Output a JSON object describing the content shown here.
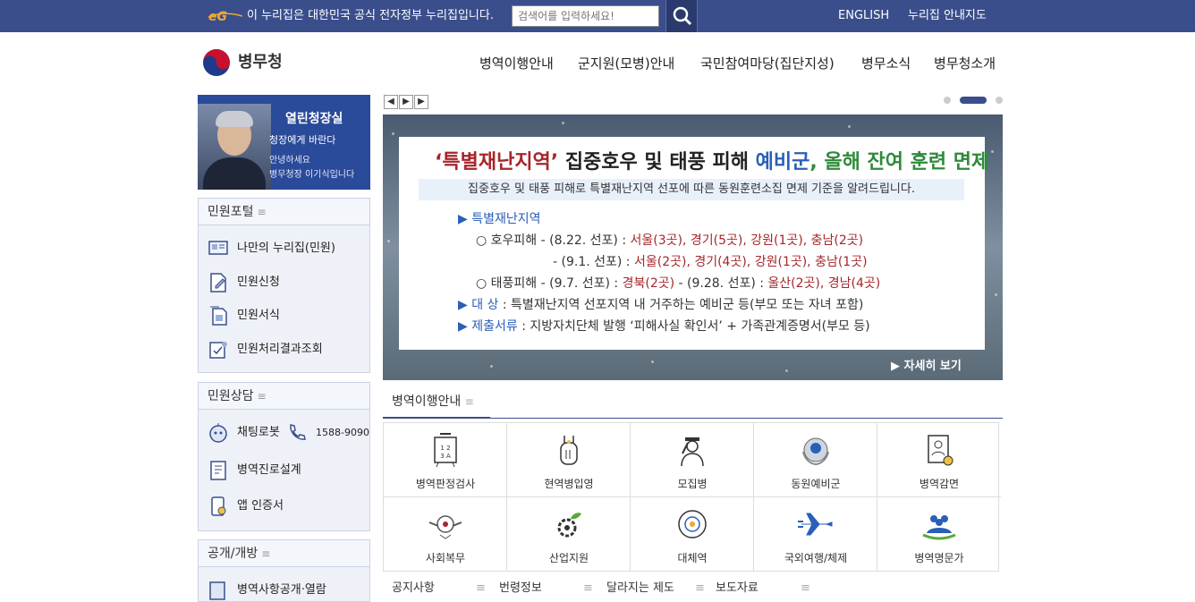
{
  "topbar": {
    "notice": "이 누리집은 대한민국 공식 전자정부 누리집입니다.",
    "search_placeholder": "검색어를 입력하세요!",
    "english": "ENGLISH",
    "sitemap": "누리집 안내지도"
  },
  "logo": {
    "name": "병무청"
  },
  "gnb": [
    "병역이행안내",
    "군지원(모병)안내",
    "국민참여마당(집단지성)",
    "병무소식",
    "병무청소개"
  ],
  "ceo": {
    "title": "열린청장실",
    "sub": "청장에게 바란다",
    "line1": "안녕하세요",
    "line2": "병무청장 이기식입니다"
  },
  "portal": {
    "title": "민원포털",
    "menu": "≡",
    "items": [
      "나만의 누리집(민원)",
      "민원신청",
      "민원서식",
      "민원처리결과조회"
    ]
  },
  "consult": {
    "title": "민원상담",
    "menu": "≡",
    "chatbot": "채팅로봇",
    "phone": "1588-9090",
    "career": "병역진로설계",
    "app": "앱 인증서"
  },
  "open": {
    "title": "공개/개방",
    "menu": "≡",
    "item1": "병역사항공개·열람"
  },
  "banner": {
    "controls": [
      "◀",
      "▶",
      "▶"
    ],
    "title_a": "‘특별재난지역’",
    "title_b": " 집중호우 및 태풍 피해 ",
    "title_c": "예비군",
    "title_d": ", 올해 잔여 훈련 면제",
    "sub": "집중호우 및 태풍 피해로 특별재난지역 선포에 따른 동원훈련소집 면제 기준을 알려드립니다.",
    "h1": "▶ 특별재난지역",
    "r1a": "○ 호우피해  - (8.22. 선포) : ",
    "r1b": "서울(3곳), 경기(5곳), 강원(1곳), 충남(2곳)",
    "r2a": "- (9.1. 선포) : ",
    "r2b": "서울(2곳), 경기(4곳), 강원(1곳), 충남(1곳)",
    "r3a": "○ 태풍피해  - (9.7. 선포) : ",
    "r3b": "경북(2곳)",
    "r3c": "  - (9.28. 선포) : ",
    "r3d": "울산(2곳), 경남(4곳)",
    "r4a": "▶ 대    상",
    "r4b": " : 특별재난지역 선포지역 내 거주하는 예비군 등(부모 또는 자녀 포함)",
    "r5a": "▶ 제출서류",
    "r5b": " : 지방자치단체 발행 ‘피해사실 확인서’ + 가족관계증명서(부모 등)",
    "more": "▶ 자세히 보기"
  },
  "tabs": {
    "active": "병역이행안내",
    "menu": "≡"
  },
  "grid": [
    "병역판정검사",
    "현역병입영",
    "모집병",
    "동원예비군",
    "병역감면",
    "사회복무",
    "산업지원",
    "대체역",
    "국외여행/체제",
    "병역명문가"
  ],
  "bottom_tabs": [
    "공지사항",
    "번령정보",
    "달라지는 제도",
    "보도자료"
  ],
  "colors": {
    "topbar": "#3a4e8c",
    "accent_red": "#a6262b",
    "accent_blue": "#2a5fb8",
    "accent_green": "#2f8a3c"
  }
}
